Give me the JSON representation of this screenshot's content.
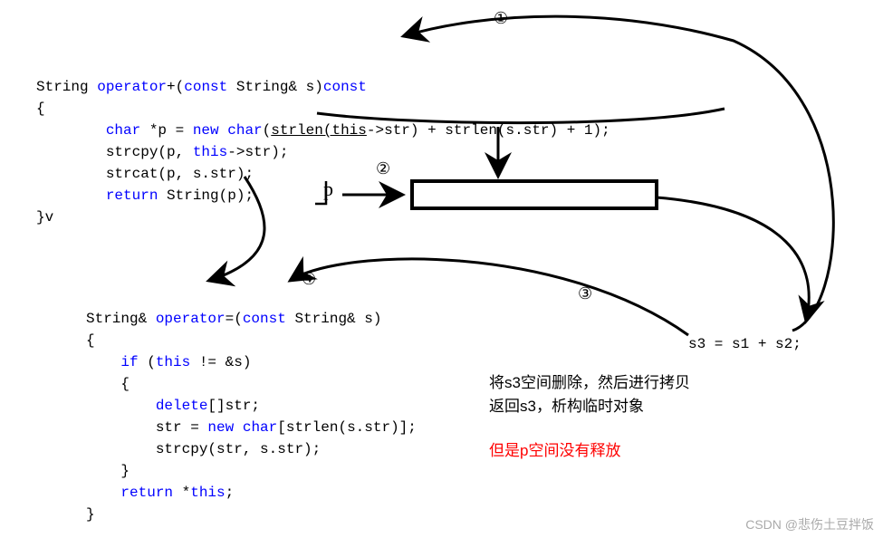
{
  "labels": {
    "n1": "①",
    "n2": "②",
    "n3": "③",
    "n4": "④"
  },
  "code1": {
    "line1a": "String ",
    "line1b": "operator",
    "line1c": "+(",
    "line1d": "const",
    "line1e": " String& s)",
    "line1f": "const",
    "line2": "{",
    "line3a": "        ",
    "line3b": "char",
    "line3c": " *p = ",
    "line3d": "new",
    "line3e": " ",
    "line3f": "char",
    "line3g": "(",
    "line3h": "strlen(this",
    "line3i": "->str) + strlen(s.str) + 1);",
    "line4a": "        strcpy(p, ",
    "line4b": "this",
    "line4c": "->str);",
    "line5": "        strcat(p, s.str);",
    "line6a": "        ",
    "line6b": "return",
    "line6c": " String(p);",
    "line7": "}v"
  },
  "plabel": "p",
  "code2": {
    "line1a": "String& ",
    "line1b": "operator",
    "line1c": "=(",
    "line1d": "const",
    "line1e": " String& s)",
    "line2": "{",
    "line3a": "    ",
    "line3b": "if",
    "line3c": " (",
    "line3d": "this",
    "line3e": " != &s)",
    "line4": "    {",
    "line5a": "        ",
    "line5b": "delete",
    "line5c": "[]str;",
    "line6a": "        str = ",
    "line6b": "new",
    "line6c": " ",
    "line6d": "char",
    "line6e": "[strlen(s.str)];",
    "line7": "        strcpy(str, s.str);",
    "line8": "    }",
    "line9a": "    ",
    "line9b": "return",
    "line9c": " *",
    "line9d": "this",
    "line9e": ";",
    "line10": "}"
  },
  "expr": "s3 = s1 + s2;",
  "note1": "将s3空间删除，然后进行拷贝",
  "note2": "返回s3，析构临时对象",
  "note3": "但是p空间没有释放",
  "watermark": "CSDN @悲伤土豆拌饭"
}
